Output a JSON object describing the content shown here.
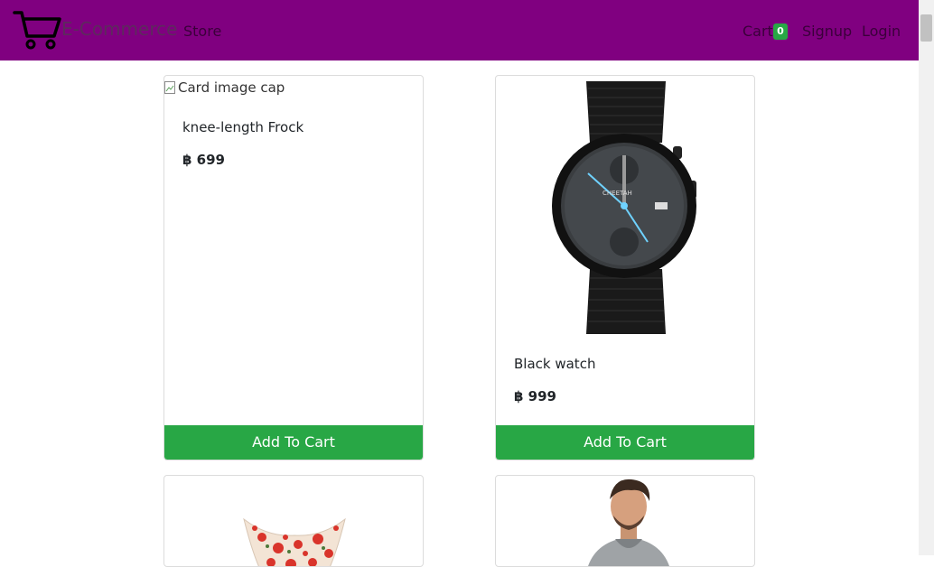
{
  "navbar": {
    "brand": "E-Commerce",
    "store": "Store",
    "cart": "Cart",
    "cart_count": "0",
    "signup": "Signup",
    "login": "Login"
  },
  "products": [
    {
      "image_alt": "Card image cap",
      "name": "knee-length Frock",
      "price": "฿ 699",
      "button": "Add To Cart"
    },
    {
      "name": "Black watch",
      "price": "฿ 999",
      "button": "Add To Cart"
    }
  ],
  "colors": {
    "navbar": "#800080",
    "button": "#28a745",
    "badge": "#28a745"
  },
  "icons": [
    "shopping-cart-icon",
    "broken-image-icon"
  ]
}
